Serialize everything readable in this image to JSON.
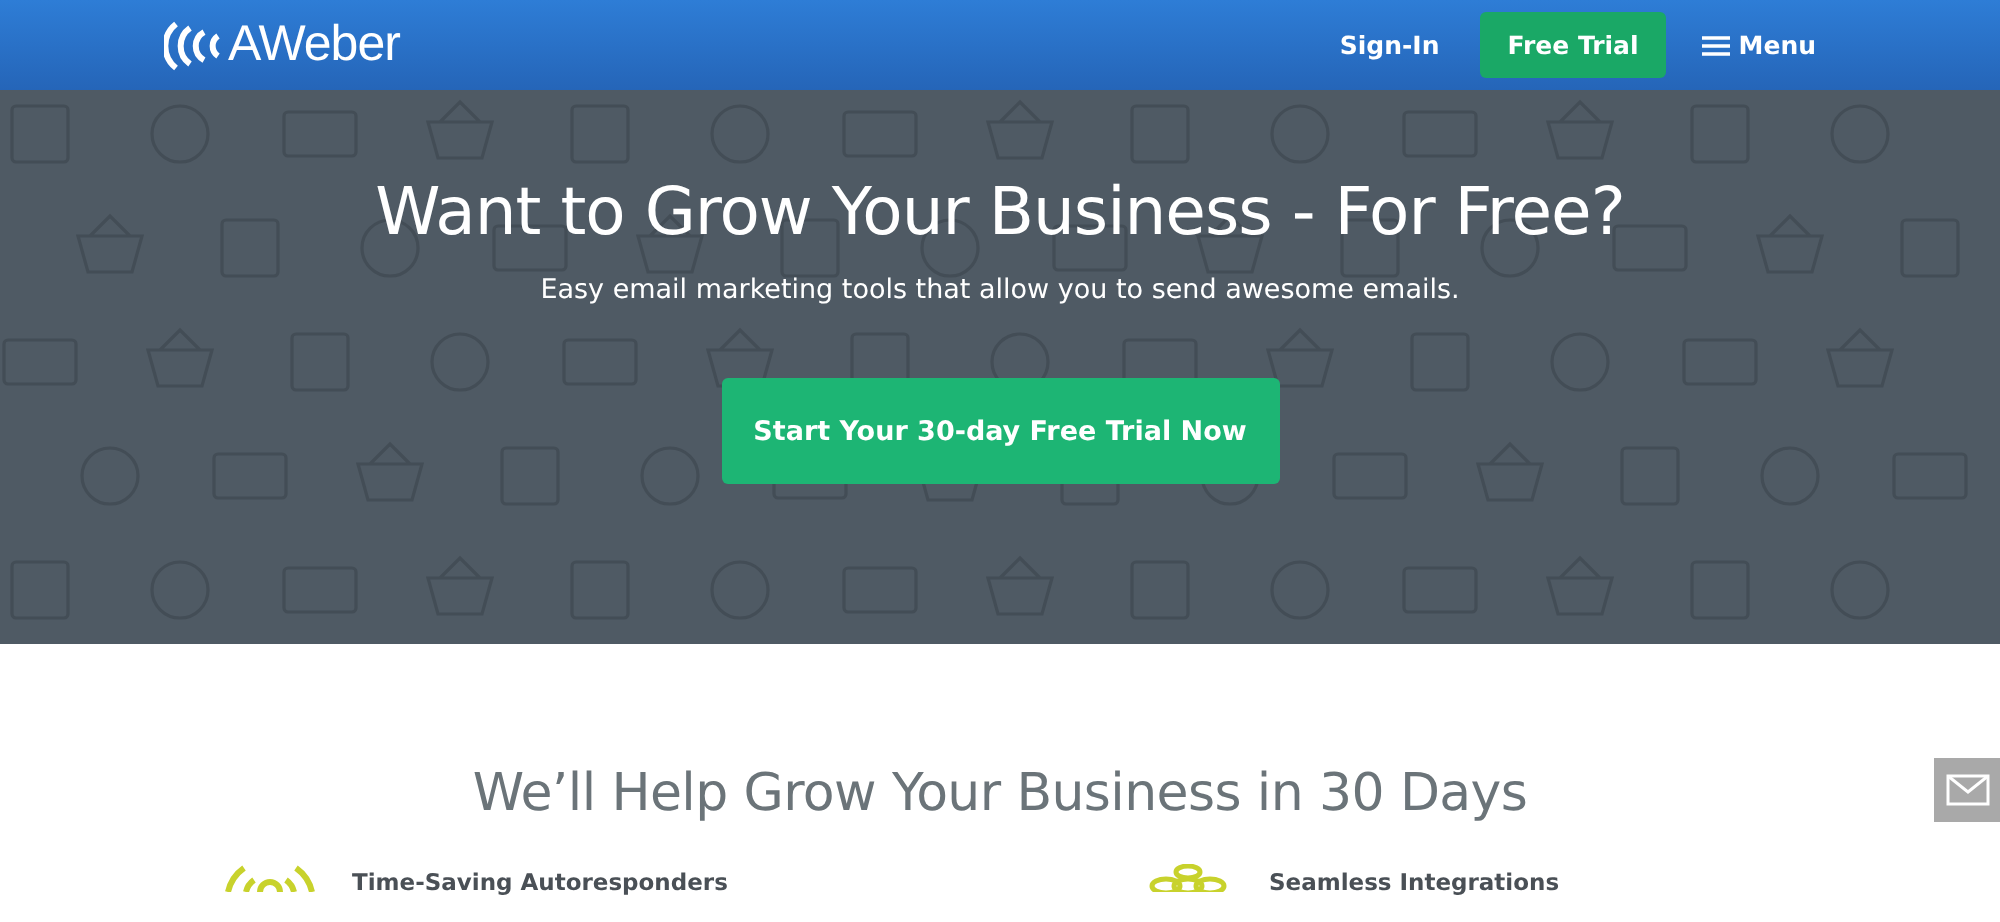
{
  "header": {
    "logo": "AWeber",
    "nav": [
      {
        "kind": "link",
        "label": "Sign-In"
      },
      {
        "kind": "button",
        "label": "Free Trial"
      },
      {
        "kind": "menu",
        "label": "Menu"
      }
    ]
  },
  "hero": {
    "title": "Want to Grow Your Business - For Free?",
    "subtitle": "Easy email marketing tools that allow you to send awesome emails.",
    "cta": "Start Your 30-day Free Trial Now"
  },
  "section": {
    "title": "We’ll Help Grow Your Business in 30 Days",
    "features": [
      {
        "kind": "autoresponder",
        "title": "Time-Saving Autoresponders"
      },
      {
        "kind": "integration",
        "title": "Seamless Integrations"
      }
    ]
  }
}
